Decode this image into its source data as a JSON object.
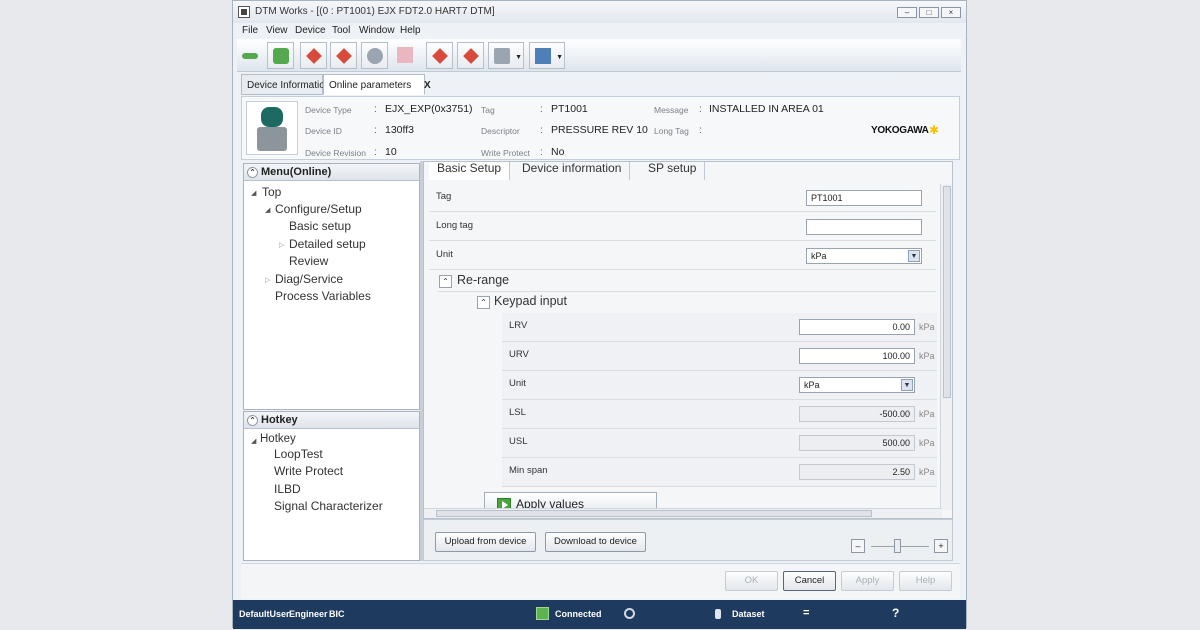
{
  "window": {
    "title": "DTM Works - [(0 : PT1001) EJX FDT2.0 HART7 DTM]",
    "controls": [
      "–",
      "□",
      "×"
    ]
  },
  "menubar": [
    "File",
    "View",
    "Device",
    "Tool",
    "Window",
    "Help"
  ],
  "tabs": [
    {
      "label": "Device Information",
      "active": false
    },
    {
      "label": "Online parameters",
      "active": true,
      "close": "X"
    }
  ],
  "device_info": {
    "device_type_label": "Device Type",
    "device_type": "EJX_EXP(0x3751)",
    "device_id_label": "Device ID",
    "device_id": "130ff3",
    "device_revision_label": "Device Revision",
    "device_revision": "10",
    "tag_label": "Tag",
    "tag": "PT1001",
    "descriptor_label": "Descriptor",
    "descriptor": "PRESSURE REV 10",
    "write_protect_label": "Write Protect",
    "write_protect": "No",
    "message_label": "Message",
    "message": "INSTALLED IN AREA 01",
    "long_tag_label": "Long Tag",
    "long_tag": "",
    "colon": ":",
    "brand": "YOKOGAWA",
    "brand_star": "✱"
  },
  "menu_pane": {
    "title": "Menu(Online)",
    "items": {
      "top": "Top",
      "configure": "Configure/Setup",
      "basic_setup": "Basic setup",
      "detailed_setup": "Detailed setup",
      "review": "Review",
      "diag": "Diag/Service",
      "process_vars": "Process Variables"
    }
  },
  "hotkey_pane": {
    "title": "Hotkey",
    "root": "Hotkey",
    "items": [
      "LoopTest",
      "Write Protect",
      "ILBD",
      "Signal Characterizer"
    ]
  },
  "content": {
    "tabs": [
      "Basic Setup",
      "Device information",
      "SP setup"
    ],
    "tag_label": "Tag",
    "tag_value": "PT1001",
    "long_tag_label": "Long tag",
    "long_tag_value": "",
    "unit_label": "Unit",
    "unit_value": "kPa",
    "rerange_title": "Re-range",
    "keypad_title": "Keypad input",
    "lrv_label": "LRV",
    "lrv_value": "0.00",
    "urv_label": "URV",
    "urv_value": "100.00",
    "unit2_label": "Unit",
    "unit2_value": "kPa",
    "lsl_label": "LSL",
    "lsl_value": "-500.00",
    "usl_label": "USL",
    "usl_value": "500.00",
    "minspan_label": "Min span",
    "minspan_value": "2.50",
    "unit_suffix": "kPa",
    "apply_label": "Apply values"
  },
  "actions": {
    "upload": "Upload from device",
    "download": "Download to device",
    "zoom_out": "–",
    "zoom_in": "+",
    "zoom_level": 0.45
  },
  "dialog": {
    "ok": "OK",
    "cancel": "Cancel",
    "apply": "Apply",
    "help": "Help"
  },
  "statusbar": {
    "user": "DefaultUser",
    "role": "Engineer",
    "code": "BIC",
    "connection": "Connected",
    "dataset": "Dataset",
    "equals": "=",
    "question": "?"
  },
  "colors": {
    "statusbar": "#1f3a5f",
    "brand_star": "#f5c400"
  }
}
